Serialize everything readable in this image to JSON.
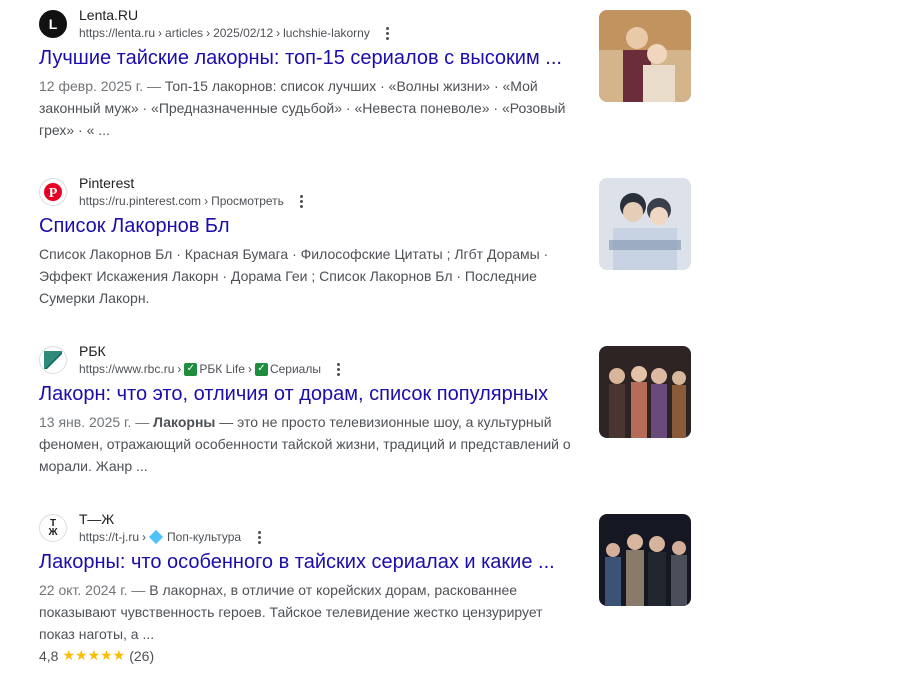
{
  "results": [
    {
      "site": "Lenta.RU",
      "url_parts": [
        "https://lenta.ru",
        "articles",
        "2025/02/12",
        "luchshie-lakorny"
      ],
      "title": "Лучшие тайские лакорны: топ-15 сериалов с высоким ...",
      "date": "12 февр. 2025 г. — ",
      "snippet": "Топ-15 лакорнов: список лучших · «Волны жизни» · «Мой законный муж» · «Предназначенные судьбой» · «Невеста поневоле» · «Розовый грех» · « ...",
      "favicon": "L",
      "favicon_icon": "lenta-logo-icon",
      "thumb_colors": [
        "#c9a06a",
        "#7a3a4a",
        "#e6d0b8"
      ]
    },
    {
      "site": "Pinterest",
      "url_parts": [
        "https://ru.pinterest.com",
        "Просмотреть"
      ],
      "title": "Список Лакорнов Бл",
      "snippet": "Список Лакорнов Бл · Красная Бумага · Философские Цитаты ; Лгбт Дорамы · Эффект Искажения Лакорн · Дорама Геи ; Список Лакорнов Бл · Последние Сумерки Лакорн.",
      "favicon_icon": "pinterest-logo-icon",
      "thumb_colors": [
        "#d8dde6",
        "#2f3a4f",
        "#9fb0c8"
      ]
    },
    {
      "site": "РБК",
      "url_parts": [
        "https://www.rbc.ru"
      ],
      "breadcrumbs": [
        "РБК Life",
        "Сериалы"
      ],
      "title": "Лакорн: что это, отличия от дорам, список популярных",
      "date": "13 янв. 2025 г. — ",
      "snippet_bold": "Лакорны",
      "snippet": " — это не просто телевизионные шоу, а культурный феномен, отражающий особенности тайской жизни, традиций и представлений о морали. Жанр ...",
      "favicon_icon": "rbc-logo-icon",
      "thumb_colors": [
        "#3a2a2a",
        "#b56d5a",
        "#6a4a7a"
      ]
    },
    {
      "site": "Т—Ж",
      "url_parts": [
        "https://t-j.ru"
      ],
      "category": "Поп-культура",
      "title": "Лакорны: что особенного в тайских сериалах и какие ...",
      "date": "22 окт. 2024 г. — ",
      "snippet": "В лакорнах, в отличие от корейских дорам, раскованнее показывают чувственность героев. Тайское телевидение жестко цензурирует показ наготы, а ...",
      "favicon": "ТЖ",
      "favicon_icon": "tj-logo-icon",
      "rating": "4,8",
      "stars": "★★★★★",
      "rating_count": "(26)",
      "thumb_colors": [
        "#1a1d2a",
        "#4a5a78",
        "#8a7a6a"
      ]
    }
  ]
}
